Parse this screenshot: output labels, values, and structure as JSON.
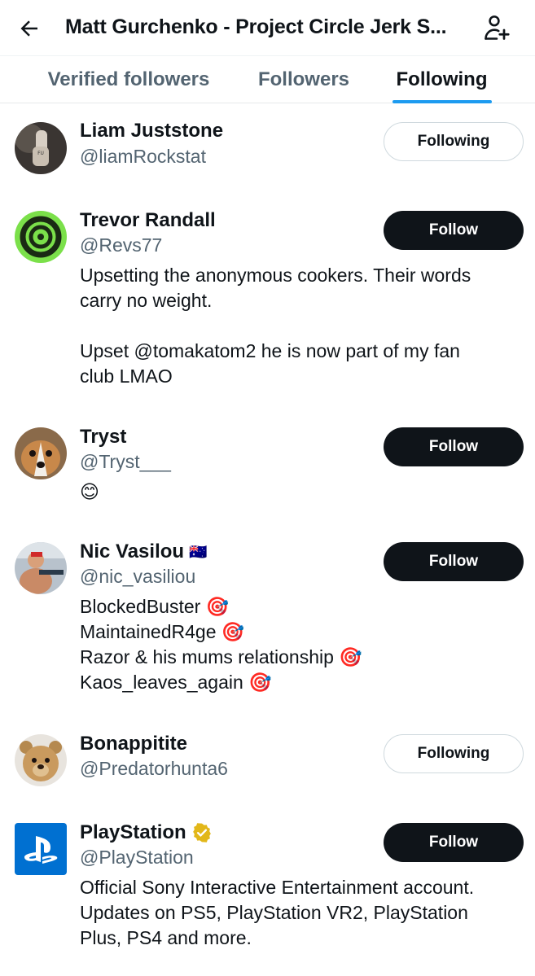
{
  "header": {
    "title": "Matt Gurchenko - Project Circle Jerk S...",
    "back_icon": "arrow-left-icon",
    "add_user_icon": "person-plus-icon"
  },
  "tabs": [
    {
      "label": "Verified followers",
      "active": false
    },
    {
      "label": "Followers",
      "active": false
    },
    {
      "label": "Following",
      "active": true
    }
  ],
  "colors": {
    "accent": "#1d9bf0",
    "dark_button": "#0f1419",
    "secondary_text": "#536471"
  },
  "users": [
    {
      "name": "Liam Juststone",
      "handle": "@liamRockstat",
      "button": "Following",
      "bio": []
    },
    {
      "name": "Trevor Randall",
      "handle": "@Revs77",
      "button": "Follow",
      "bio": [
        "Upsetting the anonymous cookers. Their words",
        "carry no weight.",
        "",
        "Upset @tomakatom2 he is now part of my fan",
        "club LMAO"
      ]
    },
    {
      "name": "Tryst",
      "handle": "@Tryst___",
      "button": "Follow",
      "bio": [
        "😊"
      ]
    },
    {
      "name": "Nic Vasilou",
      "name_badge": "🇦🇺",
      "handle": "@nic_vasiliou",
      "button": "Follow",
      "bio": [
        "BlockedBuster 🎯",
        "MaintainedR4ge 🎯",
        "Razor & his mums relationship 🎯",
        "Kaos_leaves_again 🎯"
      ]
    },
    {
      "name": "Bonappitite",
      "handle": "@Predatorhunta6",
      "button": "Following",
      "bio": []
    },
    {
      "name": "PlayStation",
      "name_badge": "verified-gold-icon",
      "handle": "@PlayStation",
      "button": "Follow",
      "bio": [
        "Official Sony Interactive Entertainment account.",
        "Updates on PS5, PlayStation VR2, PlayStation",
        "Plus, PS4 and more."
      ]
    }
  ]
}
